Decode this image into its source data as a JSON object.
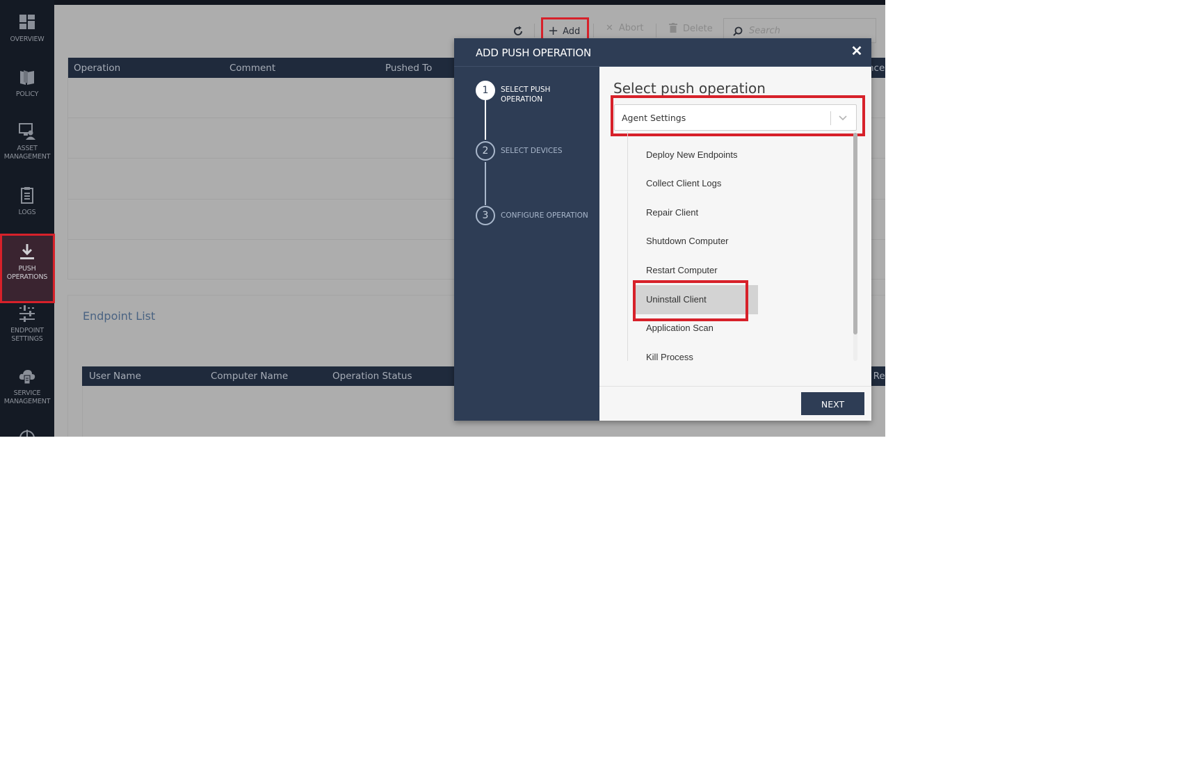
{
  "sidebar": {
    "items": [
      {
        "label_line1": "OVERVIEW",
        "label_line2": "",
        "icon": "dashboard-icon"
      },
      {
        "label_line1": "POLICY",
        "label_line2": "",
        "icon": "policy-book-icon"
      },
      {
        "label_line1": "ASSET",
        "label_line2": "MANAGEMENT",
        "icon": "monitor-user-icon"
      },
      {
        "label_line1": "LOGS",
        "label_line2": "",
        "icon": "clipboard-icon"
      },
      {
        "label_line1": "PUSH",
        "label_line2": "OPERATIONS",
        "icon": "download-icon",
        "active": true
      },
      {
        "label_line1": "ENDPOINT",
        "label_line2": "SETTINGS",
        "icon": "sliders-icon"
      },
      {
        "label_line1": "SERVICE",
        "label_line2": "MANAGEMENT",
        "icon": "cloud-server-icon"
      }
    ]
  },
  "toolbar": {
    "refresh_icon": "refresh-icon",
    "add_label": "Add",
    "abort_label": "Abort",
    "delete_label": "Delete",
    "search_placeholder": "Search"
  },
  "operations_table": {
    "columns": [
      "Operation",
      "Comment",
      "Pushed To",
      "nce"
    ],
    "rows": []
  },
  "endpoint_list": {
    "title": "Endpoint List",
    "columns": [
      "User Name",
      "Computer Name",
      "Operation Status",
      "e Re"
    ]
  },
  "modal": {
    "title": "ADD PUSH OPERATION",
    "steps": [
      {
        "number": "1",
        "label_line1": "SELECT PUSH",
        "label_line2": "OPERATION",
        "active": true
      },
      {
        "number": "2",
        "label_line1": "SELECT DEVICES",
        "label_line2": "",
        "active": false
      },
      {
        "number": "3",
        "label_line1": "CONFIGURE OPERATION",
        "label_line2": "",
        "active": false
      }
    ],
    "content_title": "Select push operation",
    "dropdown": {
      "selected_value": "Agent Settings",
      "options": [
        "Deploy New Endpoints",
        "Collect Client Logs",
        "Repair Client",
        "Shutdown Computer",
        "Restart Computer",
        "Uninstall Client",
        "Application Scan",
        "Kill Process"
      ],
      "highlighted_option": "Uninstall Client"
    },
    "next_label": "NEXT"
  },
  "colors": {
    "sidebar_bg": "#141a24",
    "modal_header": "#2e3d55",
    "highlight_red": "#d7212a",
    "overlay_gray": "#adadad",
    "table_header": "#1f2a3c"
  }
}
